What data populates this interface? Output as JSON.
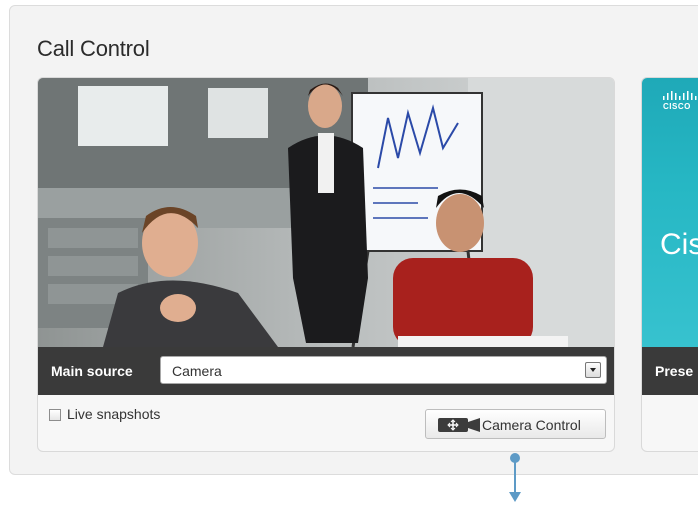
{
  "panel": {
    "title": "Call Control"
  },
  "main_card": {
    "source_label": "Main source",
    "source_select_value": "Camera",
    "live_snapshots_label": "Live snapshots",
    "live_snapshots_checked": false,
    "camera_control_label": "Camera Control"
  },
  "presentation_card": {
    "logo_text": "CISCO",
    "screen_text": "Cis",
    "source_label": "Prese"
  },
  "colors": {
    "source_bar": "#3a3a3a",
    "presentation_screen": "#26b7c4",
    "callout_arrow": "#5d9ac6"
  }
}
